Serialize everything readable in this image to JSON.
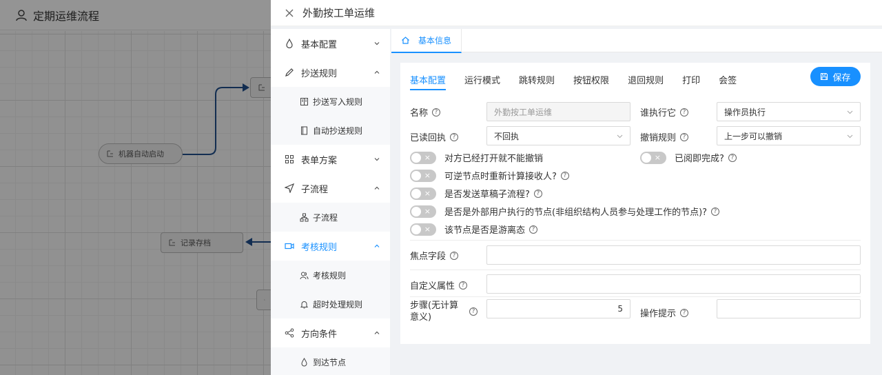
{
  "app": {
    "title": "定期运维流程",
    "nodes": {
      "auto_start": "机器自动启动",
      "record_archive": "记录存档"
    }
  },
  "drawer": {
    "title": "外勤按工单运维",
    "menu": [
      {
        "label": "基本配置",
        "icon": "drop-icon",
        "expanded": false
      },
      {
        "label": "抄送规则",
        "icon": "pencil-icon",
        "expanded": true,
        "children": [
          {
            "label": "抄送写入规则",
            "icon": "book-icon"
          },
          {
            "label": "自动抄送规则",
            "icon": "doc-icon"
          }
        ]
      },
      {
        "label": "表单方案",
        "icon": "grid-icon",
        "expanded": false
      },
      {
        "label": "子流程",
        "icon": "send-icon",
        "expanded": true,
        "children": [
          {
            "label": "子流程",
            "icon": "tree-icon"
          }
        ]
      },
      {
        "label": "考核规则",
        "icon": "video-icon",
        "expanded": true,
        "active": true,
        "children": [
          {
            "label": "考核规则",
            "icon": "users-icon"
          },
          {
            "label": "超时处理规则",
            "icon": "bell-icon"
          }
        ]
      },
      {
        "label": "方向条件",
        "icon": "share-icon",
        "expanded": true,
        "children": [
          {
            "label": "到达节点",
            "icon": "drop-icon"
          }
        ]
      }
    ],
    "main_tab": "基本信息",
    "subtabs": [
      "基本配置",
      "运行模式",
      "跳转规则",
      "按钮权限",
      "退回规则",
      "打印",
      "会签"
    ],
    "save_label": "保存",
    "form": {
      "name_label": "名称",
      "name_value": "外勤按工单运维",
      "who_exec_label": "谁执行它",
      "who_exec_value": "操作员执行",
      "read_receipt_label": "已读回执",
      "read_receipt_value": "不回执",
      "withdraw_label": "撤销规则",
      "withdraw_value": "上一步可以撤销",
      "toggles": {
        "t1": "对方已经打开就不能撤销",
        "t_right": "已阅即完成?",
        "t2": "可逆节点时重新计算接收人?",
        "t3": "是否发送草稿子流程?",
        "t4": "是否是外部用户执行的节点(非组织结构人员参与处理工作的节点)?",
        "t5": "该节点是否是游离态"
      },
      "focus_field_label": "焦点字段",
      "focus_field_value": "",
      "custom_attr_label": "自定义属性",
      "custom_attr_value": "",
      "step_label": "步骤(无计算意义)",
      "step_value": "5",
      "op_hint_label": "操作提示",
      "op_hint_value": ""
    },
    "accent": "#1890ff"
  }
}
